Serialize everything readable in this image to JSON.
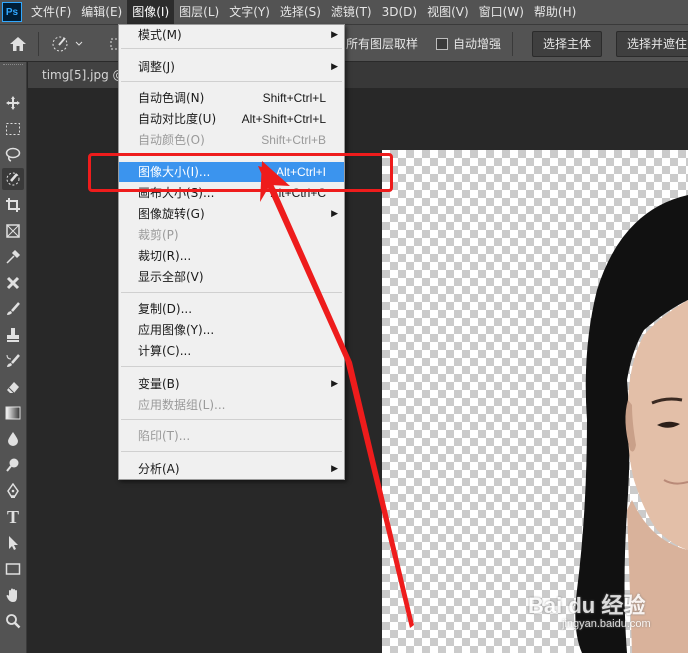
{
  "menubar": {
    "logo": "Ps",
    "items": [
      "文件(F)",
      "编辑(E)",
      "图像(I)",
      "图层(L)",
      "文字(Y)",
      "选择(S)",
      "滤镜(T)",
      "3D(D)",
      "视图(V)",
      "窗口(W)",
      "帮助(H)"
    ],
    "active_index": 2
  },
  "options_bar": {
    "sample_all_layers": "所有图层取样",
    "auto_enhance": "自动增强",
    "select_subject": "选择主体",
    "select_and_mask": "选择并遮住"
  },
  "document_tab": {
    "title": "timg[5].jpg @"
  },
  "image_menu": {
    "items": [
      {
        "label": "模式(M)",
        "submenu": true
      },
      {
        "label": "调整(J)",
        "submenu": true
      },
      {
        "label": "自动色调(N)",
        "shortcut": "Shift+Ctrl+L"
      },
      {
        "label": "自动对比度(U)",
        "shortcut": "Alt+Shift+Ctrl+L"
      },
      {
        "label": "自动颜色(O)",
        "shortcut": "Shift+Ctrl+B",
        "disabled": true
      },
      {
        "label": "图像大小(I)...",
        "shortcut": "Alt+Ctrl+I",
        "highlighted": true
      },
      {
        "label": "画布大小(S)...",
        "shortcut": "Alt+Ctrl+C"
      },
      {
        "label": "图像旋转(G)",
        "submenu": true
      },
      {
        "label": "裁剪(P)",
        "disabled": true
      },
      {
        "label": "裁切(R)..."
      },
      {
        "label": "显示全部(V)"
      },
      {
        "label": "复制(D)..."
      },
      {
        "label": "应用图像(Y)..."
      },
      {
        "label": "计算(C)..."
      },
      {
        "label": "变量(B)",
        "submenu": true
      },
      {
        "label": "应用数据组(L)...",
        "disabled": true
      },
      {
        "label": "陷印(T)...",
        "disabled": true
      },
      {
        "label": "分析(A)",
        "submenu": true
      }
    ]
  },
  "watermark": {
    "brand": "Bai du 经验",
    "url": "jingyan.baidu.com"
  },
  "colors": {
    "highlight": "#3b94ee",
    "annotation_red": "#ee1c1c"
  },
  "tools": [
    "move-icon",
    "marquee-icon",
    "lasso-icon",
    "quick-select-icon",
    "crop-icon",
    "frame-icon",
    "eyedropper-icon",
    "healing-icon",
    "brush-icon",
    "stamp-icon",
    "history-brush-icon",
    "eraser-icon",
    "gradient-icon",
    "blur-icon",
    "dodge-icon",
    "pen-icon",
    "type-icon",
    "path-select-icon",
    "rectangle-icon",
    "hand-icon",
    "zoom-icon"
  ]
}
